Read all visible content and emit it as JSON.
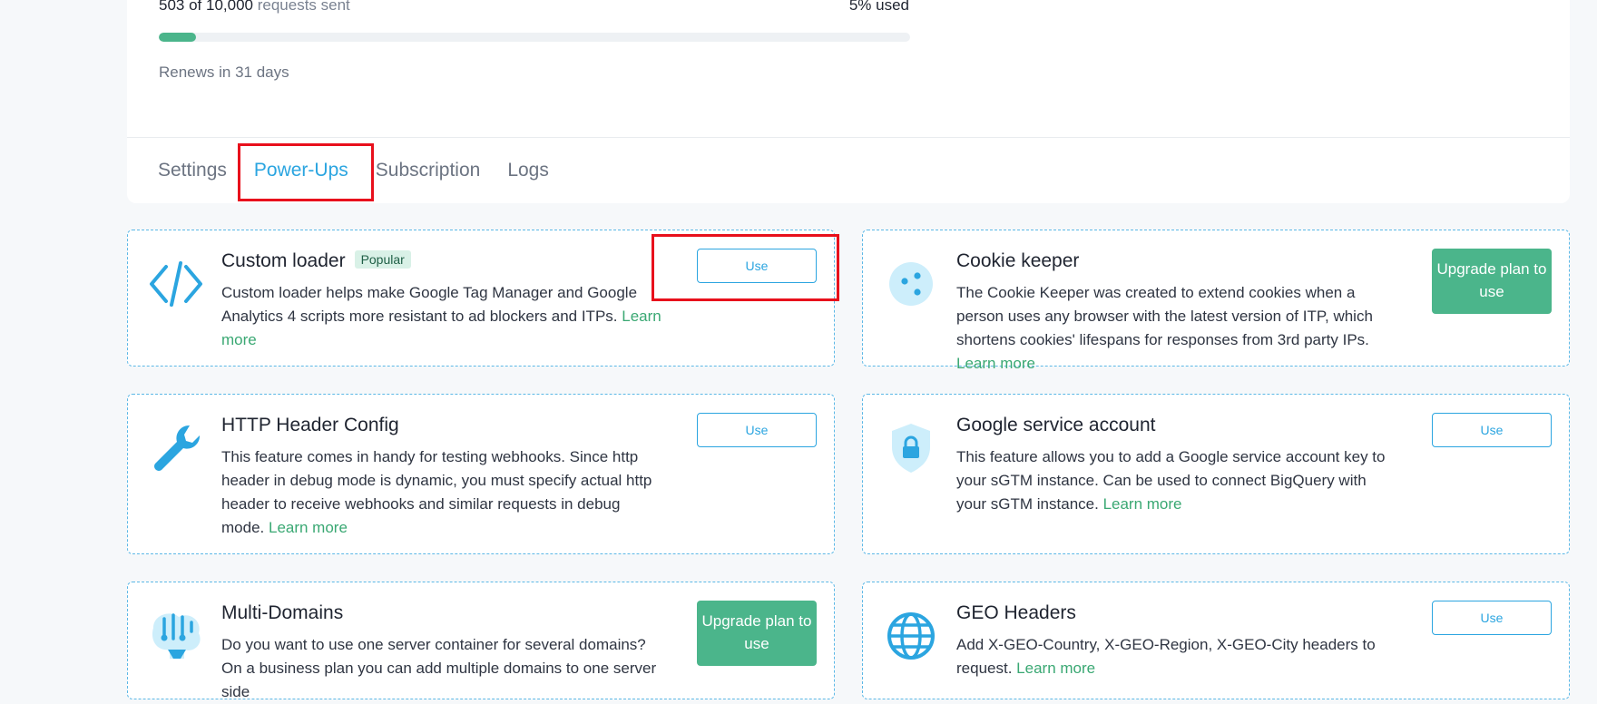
{
  "usage": {
    "sent": "503 of 10,000",
    "sent_suffix": "requests sent",
    "percent_label": "5% used",
    "progress_fraction": 0.05,
    "renews": "Renews in 31 days"
  },
  "tabs": [
    {
      "label": "Settings"
    },
    {
      "label": "Power-Ups"
    },
    {
      "label": "Subscription"
    },
    {
      "label": "Logs"
    }
  ],
  "cards": [
    {
      "title": "Custom loader",
      "badge": "Popular",
      "desc": "Custom loader helps make Google Tag Manager and Google Analytics 4 scripts more resistant to ad blockers and ITPs.",
      "link": "Learn more",
      "button": "Use",
      "icon": "code-icon"
    },
    {
      "title": "Cookie keeper",
      "desc": "The Cookie Keeper was created to extend cookies when a person uses any browser with the latest version of ITP, which shortens cookies' lifespans for responses from 3rd party IPs.",
      "link": "Learn more",
      "button": "Upgrade plan to use",
      "icon": "cookie-icon"
    },
    {
      "title": "HTTP Header Config",
      "desc": "This feature comes in handy for testing webhooks. Since http header in debug mode is dynamic, you must specify actual http header to receive webhooks and similar requests in debug mode.",
      "link": "Learn more",
      "button": "Use",
      "icon": "wrench-icon"
    },
    {
      "title": "Google service account",
      "desc": "This feature allows you to add a Google service account key to your sGTM instance. Can be used to connect BigQuery with your sGTM instance.",
      "link": "Learn more",
      "button": "Use",
      "icon": "shield-lock-icon"
    },
    {
      "title": "Multi-Domains",
      "desc": "Do you want to use one server container for several domains? On a business plan you can add multiple domains to one server side",
      "button": "Upgrade plan to use",
      "icon": "multi-domain-icon"
    },
    {
      "title": "GEO Headers",
      "desc": "Add X-GEO-Country, X-GEO-Region, X-GEO-City headers to request.",
      "link": "Learn more",
      "button": "Use",
      "icon": "globe-icon"
    }
  ],
  "colors": {
    "accent_blue": "#2ba5e0",
    "accent_green": "#4bb58b",
    "highlight_red": "#e8101c"
  }
}
